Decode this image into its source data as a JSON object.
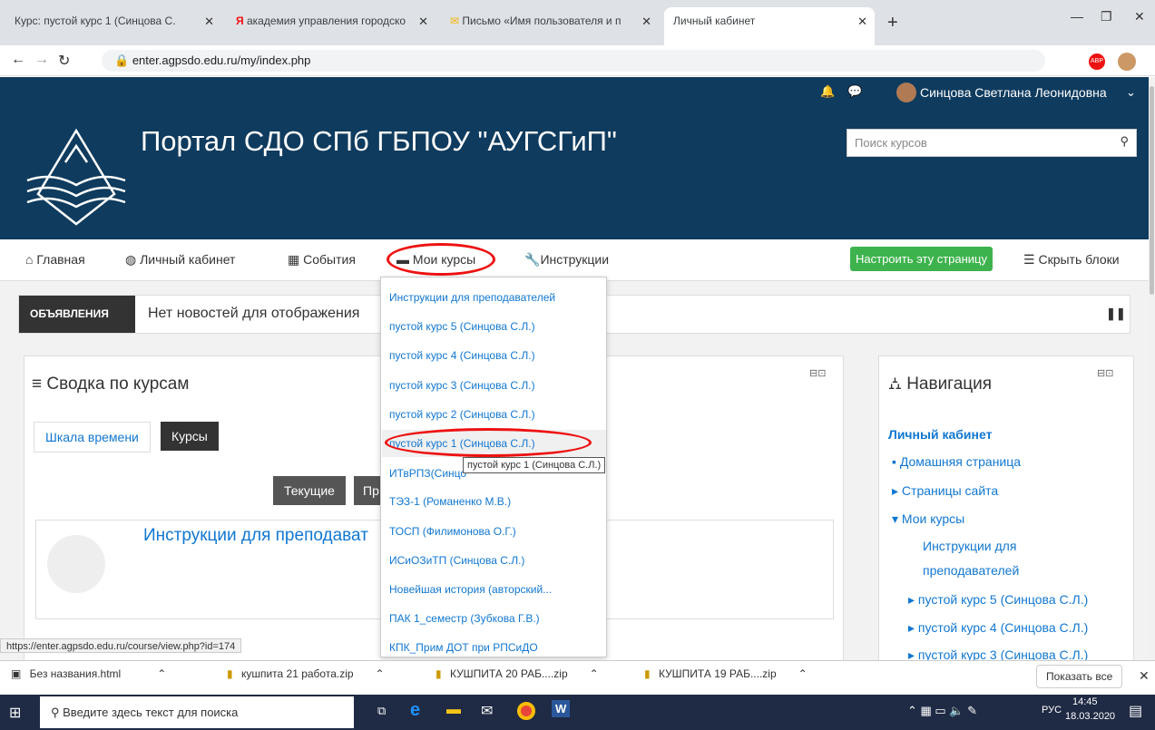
{
  "tabs": [
    "Курс: пустой курс 1 (Синцова С.",
    "академия управления городско",
    "Письмо «Имя пользователя и п",
    "Личный кабинет"
  ],
  "url": "enter.agpsdo.edu.ru/my/index.php",
  "user": "Синцова Светлана Леонидовна",
  "site_title": "Портал СДО СПб ГБПОУ \"АУГСГиП\"",
  "search_placeholder": "Поиск курсов",
  "nav": {
    "home": "Главная",
    "cabinet": "Личный кабинет",
    "events": "События",
    "mycourses": "Мои курсы",
    "instructions": "Инструкции",
    "customize": "Настроить эту страницу",
    "hide": "Скрыть блоки"
  },
  "announce": {
    "label": "ОБЪЯВЛЕНИЯ",
    "text": "Нет новостей для отображения"
  },
  "summary": {
    "title": "Сводка по курсам",
    "tab1": "Шкала времени",
    "tab2": "Курсы",
    "btn": "Текущие",
    "btn2": "Пр",
    "course": "Инструкции для преподават"
  },
  "dropdown": [
    "Инструкции для преподавателей",
    "пустой курс 5 (Синцова С.Л.)",
    "пустой курс 4 (Синцова С.Л.)",
    "пустой курс 3 (Синцова С.Л.)",
    "пустой курс 2 (Синцова С.Л.)",
    "пустой курс 1 (Синцова С.Л.)",
    "ИТвРПЗ(Синцо",
    "ТЭЗ-1 (Романенко М.В.)",
    "ТОСП (Филимонова О.Г.)",
    "ИСиОЗиТП (Синцова С.Л.)",
    "Новейшая история (авторский...",
    "ПАК 1_семестр (Зубкова Г.В.)",
    "КПК_Прим ДОТ при РПСиДО"
  ],
  "tooltip": "пустой курс 1 (Синцова С.Л.)",
  "navblock": {
    "title": "Навигация",
    "cabinet": "Личный кабинет",
    "home": "Домашняя страница",
    "pages": "Страницы сайта",
    "my": "Мои курсы",
    "c0a": "Инструкции для",
    "c0b": "преподавателей",
    "c5": "пустой курс 5 (Синцова С.Л.)",
    "c4": "пустой курс 4 (Синцова С.Л.)",
    "c3": "пустой курс 3 (Синцова С.Л.)"
  },
  "status_url": "https://enter.agpsdo.edu.ru/course/view.php?id=174",
  "downloads": [
    "Без названия.html",
    "кушпита 21 работа.zip",
    "КУШПИТА 20 РАБ....zip",
    "КУШПИТА 19 РАБ....zip"
  ],
  "show_all": "Показать все",
  "taskbar": {
    "search": "Введите здесь текст для поиска",
    "lang": "РУС",
    "time": "14:45",
    "date": "18.03.2020"
  }
}
